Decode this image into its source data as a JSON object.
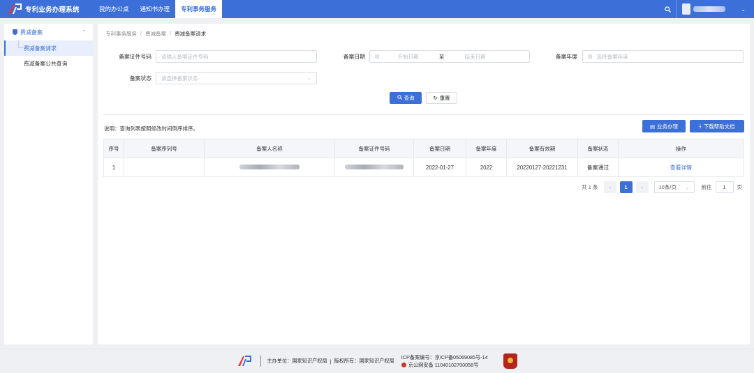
{
  "header": {
    "app_title": "专利业务办理系统",
    "nav": [
      "我的办公桌",
      "通知书办理",
      "专利事务服务"
    ],
    "active_nav_index": 2
  },
  "sidebar": {
    "group_label": "费减备案",
    "items": [
      {
        "label": "费减备案请求",
        "active": true
      },
      {
        "label": "费减备案公共查询",
        "active": false
      }
    ]
  },
  "breadcrumb": [
    "专利事务服务",
    "费减备案",
    "费减备案请求"
  ],
  "form": {
    "cert_label": "备案证件号码",
    "cert_placeholder": "请输入备案证件号码",
    "date_label": "备案日期",
    "date_start_placeholder": "开始日期",
    "date_to": "至",
    "date_end_placeholder": "结束日期",
    "year_label": "备案年度",
    "year_placeholder": "选择备案年度",
    "status_label": "备案状态",
    "status_placeholder": "请选择备案状态",
    "query_button": "查询",
    "reset_button": "重置"
  },
  "note": "说明：查询列表按照修改时间倒序排序。",
  "actions": {
    "business_button": "业务办理",
    "download_button": "下载帮助文档"
  },
  "table": {
    "headers": [
      "序号",
      "备案序列号",
      "备案人名称",
      "备案证件号码",
      "备案日期",
      "备案年度",
      "备案有效期",
      "备案状态",
      "操作"
    ],
    "rows": [
      {
        "index": "1",
        "serial": "",
        "name": "",
        "cert_no": "",
        "date": "2022-01-27",
        "year": "2022",
        "validity": "20220127-20221231",
        "status": "备案通过",
        "action": "查看详情"
      }
    ]
  },
  "pagination": {
    "total": "共 1 条",
    "prev": "‹",
    "current_page": "1",
    "next": "›",
    "page_size": "10条/页",
    "goto_label": "前往",
    "goto_value": "1",
    "page_unit": "页"
  },
  "footer": {
    "sponsor": "主办单位：国家知识产权局",
    "copyright": "版权所有：国家知识产权局",
    "icp": "ICP备案编号：京ICP备05069085号-14",
    "police": "京公网安备 11040102700058号"
  },
  "colors": {
    "primary": "#3c6fd8",
    "link": "#3c6fd8",
    "page_bg": "#eef0f4"
  }
}
